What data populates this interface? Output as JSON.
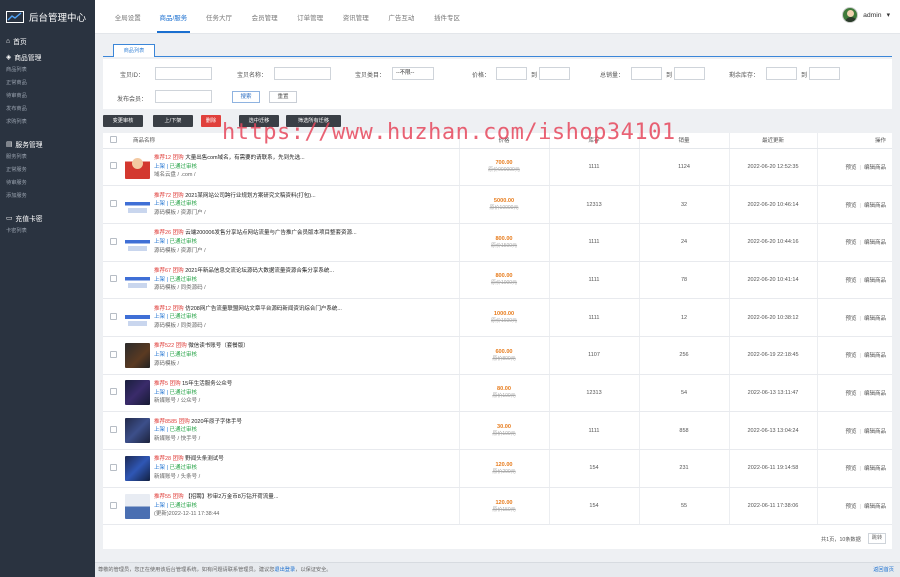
{
  "app": {
    "title": "后台管理中心"
  },
  "sidebar": {
    "home": "首页",
    "groups": [
      {
        "title": "商品管理",
        "items": [
          "商品列表",
          "正常商品",
          "待审商品",
          "发布商品",
          "求购列表"
        ]
      },
      {
        "title": "服务管理",
        "items": [
          "服务列表",
          "正常服务",
          "待审服务",
          "添加服务"
        ]
      },
      {
        "title": "充值卡密",
        "items": [
          "卡密列表"
        ]
      }
    ]
  },
  "topnav": {
    "tabs": [
      "全局设置",
      "商品/服务",
      "任务大厅",
      "会员管理",
      "订单管理",
      "资讯管理",
      "广告互动",
      "插件专区"
    ],
    "active": 1
  },
  "user": {
    "name": "admin",
    "caret": "▾"
  },
  "subtab": "商品列表",
  "filters": {
    "goods_id": "宝贝ID：",
    "goods_name": "宝贝名称：",
    "goods_cat": "宝贝类目：",
    "cat_value": "--不限--",
    "price": "价格：",
    "to": "到",
    "sales": "总销量：",
    "stock": "剩余库存：",
    "publisher": "发布会员：",
    "search": "搜索",
    "reset": "重置"
  },
  "actions": [
    "变更审核",
    "上/下架",
    "删除",
    "选中迁移",
    "筛选所有迁移"
  ],
  "table": {
    "headers": [
      "",
      "商品名称",
      "价格",
      "库存",
      "销量",
      "最近更新",
      "操作"
    ],
    "rows": [
      {
        "tag": "推荐12 团购",
        "title": "大量出售com域名，有需要的请联系，先到先选...",
        "status": "上架",
        "audit": "已通过审核",
        "cat": "域名云盘 / .com /",
        "price": "700.00",
        "old": "原价900000元",
        "stock": "1111",
        "sales": "1124",
        "time": "2022-06-20 12:52:35"
      },
      {
        "tag": "推荐72 团购",
        "title": "2021某网站公司跨行业规划方案研究文稿资料(打包)...",
        "status": "上架",
        "audit": "已通过审核",
        "cat": "源码模板 / 资源门户 /",
        "price": "5000.00",
        "old": "原价10000元",
        "stock": "12313",
        "sales": "32",
        "time": "2022-06-20 10:46:14"
      },
      {
        "tag": "推荐26 团购",
        "title": "云端200006发售分享站点网站流量与广告推广会员版本项目整套资源...",
        "status": "上架",
        "audit": "已通过审核",
        "cat": "源码模板 / 资源门户 /",
        "price": "800.00",
        "old": "原价1500元",
        "stock": "1111",
        "sales": "24",
        "time": "2022-06-20 10:44:16"
      },
      {
        "tag": "推荐67 团购",
        "title": "2021年新品信息交流论坛源码大数据流量资源合集分享系统...",
        "status": "上架",
        "audit": "已通过审核",
        "cat": "源码模板 / 同类源码 /",
        "price": "800.00",
        "old": "原价1000元",
        "stock": "1111",
        "sales": "78",
        "time": "2022-06-20 10:41:14"
      },
      {
        "tag": "推荐12 团购",
        "title": "仿208网广告流量联盟网站文章平台源码新闻资讯综合门户系统...",
        "status": "上架",
        "audit": "已通过审核",
        "cat": "源码模板 / 同类源码 /",
        "price": "1000.00",
        "old": "原价1600元",
        "stock": "1111",
        "sales": "12",
        "time": "2022-06-20 10:38:12"
      },
      {
        "tag": "推荐522 团购",
        "title": "微信读书账号（套餐版）",
        "status": "上架",
        "audit": "已通过审核",
        "cat": "源码模板 /",
        "price": "600.00",
        "old": "原价800元",
        "stock": "1107",
        "sales": "256",
        "time": "2022-06-19 22:18:45"
      },
      {
        "tag": "推荐5 团购",
        "title": "15年生活服务公众号",
        "status": "上架",
        "audit": "已通过审核",
        "cat": "新媒账号 / 公众号 /",
        "price": "80.00",
        "old": "原价100元",
        "stock": "12313",
        "sales": "54",
        "time": "2022-06-13 13:11:47"
      },
      {
        "tag": "推荐8585 团购",
        "title": "2020年原子字体手号",
        "status": "上架",
        "audit": "已通过审核",
        "cat": "新媒账号 / 快手号 /",
        "price": "30.00",
        "old": "原价100元",
        "stock": "1111",
        "sales": "858",
        "time": "2022-06-13 13:04:24"
      },
      {
        "tag": "推荐28 团购",
        "title": "野闻头条测试号",
        "status": "上架",
        "audit": "已通过审核",
        "cat": "新媒账号 / 头条号 /",
        "price": "120.00",
        "old": "原价200元",
        "stock": "154",
        "sales": "231",
        "time": "2022-06-11 19:14:58"
      },
      {
        "tag": "推荐55 团购",
        "title": "【招聘】秒审2万金币8万钻开荷流量...",
        "status": "上架",
        "audit": "已通过审核",
        "cat": "(更新)2022-12-11 17:38:44",
        "price": "120.00",
        "old": "原价150元",
        "stock": "154",
        "sales": "55",
        "time": "2022-06-11 17:38:06"
      }
    ],
    "op_preview": "预览",
    "op_edit": "编辑商品"
  },
  "pager": {
    "prev2": "«",
    "prev": "‹",
    "page_label": "第",
    "current": "1",
    "page_unit": "页",
    "next": "›",
    "next2": "»",
    "summary": "共1页，10条数据",
    "go": "跳转"
  },
  "footer": {
    "text": "尊敬的管理员，您正在使用该后台管理系统，如有问题请联系管理员。建议您",
    "link": "退出登录",
    "tail": "，以保证安全。",
    "right": "返回首页"
  },
  "watermark": "https://www.huzhan.com/ishop34101"
}
